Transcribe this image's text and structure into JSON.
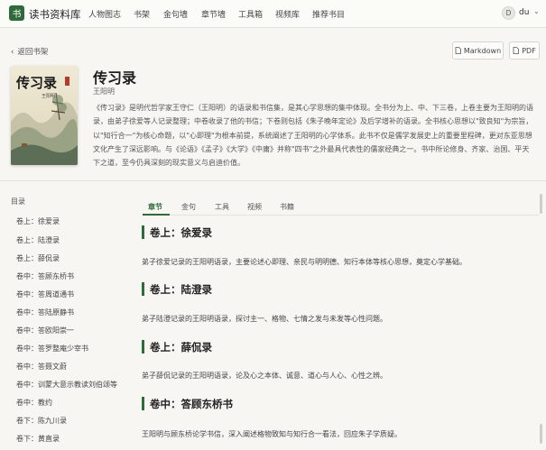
{
  "header": {
    "logo_char": "书",
    "site_name": "读书资料库",
    "nav": [
      "人物图志",
      "书架",
      "金句墙",
      "章节墙",
      "工具箱",
      "视频库",
      "推荐书目"
    ],
    "user": {
      "avatar": "D",
      "name": "du",
      "chevron": "⌄"
    }
  },
  "toolbar": {
    "back_label": "返回书架",
    "markdown_label": "Markdown",
    "pdf_label": "PDF"
  },
  "book": {
    "title": "传习录",
    "author": "王阳明",
    "cover_text": "传习录",
    "cover_subtext": "王阳明",
    "description": "《传习录》是明代哲学家王守仁（王阳明）的语录和书信集，是其心学思想的集中体现。全书分为上、中、下三卷，上卷主要为王阳明的语录，由弟子徐爱等人记录整理；中卷收录了他的书信；下卷则包括《朱子晚年定论》及后学增补的语录。全书核心思想以\"致良知\"为宗旨，以\"知行合一\"为核心命题，以\"心即理\"为根本前提，系统阐述了王阳明的心学体系。此书不仅是儒学发展史上的重要里程碑，更对东亚思想文化产生了深远影响。与《论语》《孟子》《大学》《中庸》并称\"四书\"之外最具代表性的儒家经典之一。书中所论修身、齐家、治国、平天下之道，至今仍具深刻的现实意义与启迪价值。"
  },
  "toc": {
    "title": "目录",
    "items": [
      "卷上：徐爱录",
      "卷上：陆澄录",
      "卷上：薛侃录",
      "卷中：答顾东桥书",
      "卷中：答周道通书",
      "卷中：答陆原静书",
      "卷中：答欧阳崇一",
      "卷中：答罗整庵少宰书",
      "卷中：答聂文蔚",
      "卷中：训蒙大意示教读刘伯颂等",
      "卷中：教约",
      "卷下：陈九川录",
      "卷下：黄直录"
    ]
  },
  "tabs": [
    "章节",
    "金句",
    "工具",
    "视频",
    "书籍"
  ],
  "sections": [
    {
      "title": "卷上：徐爱录",
      "desc": "弟子徐爱记录的王阳明语录，主要论述心即理、亲民与明明德、知行本体等核心思想，奠定心学基础。"
    },
    {
      "title": "卷上：陆澄录",
      "desc": "弟子陆澄记录的王阳明语录，探讨主一、格物、七情之发与未发等心性问题。"
    },
    {
      "title": "卷上：薛侃录",
      "desc": "弟子薛侃记录的王阳明语录，论及心之本体、诚意、道心与人心、心性之辨。"
    },
    {
      "title": "卷中：答顾东桥书",
      "desc": "王阳明与顾东桥论学书信，深入阐述格物致知与知行合一看法，回应朱子学质疑。"
    }
  ],
  "colors": {
    "accent": "#2f6b3a",
    "background": "#f7f6f2"
  }
}
